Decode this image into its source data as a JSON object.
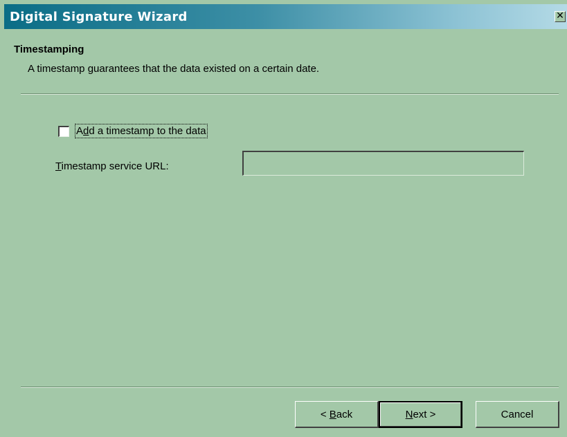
{
  "window": {
    "title": "Digital Signature Wizard",
    "close_glyph": "✕",
    "close_icon": "close-icon"
  },
  "header": {
    "title": "Timestamping",
    "description": "A timestamp guarantees that the data existed on a certain date."
  },
  "timestamp_option": {
    "label_prefix": "A",
    "label_accel": "d",
    "label_rest": "d a timestamp to the data",
    "checked": false
  },
  "url_field": {
    "label_accel": "T",
    "label_rest": "imestamp service URL:",
    "value": ""
  },
  "buttons": {
    "back_prefix": "< ",
    "back_accel": "B",
    "back_rest": "ack",
    "next_accel": "N",
    "next_rest": "ext >",
    "cancel": "Cancel"
  },
  "colors": {
    "face": "#a3c8a8",
    "title_start": "#0a6d86",
    "title_end": "#b4dae6"
  }
}
